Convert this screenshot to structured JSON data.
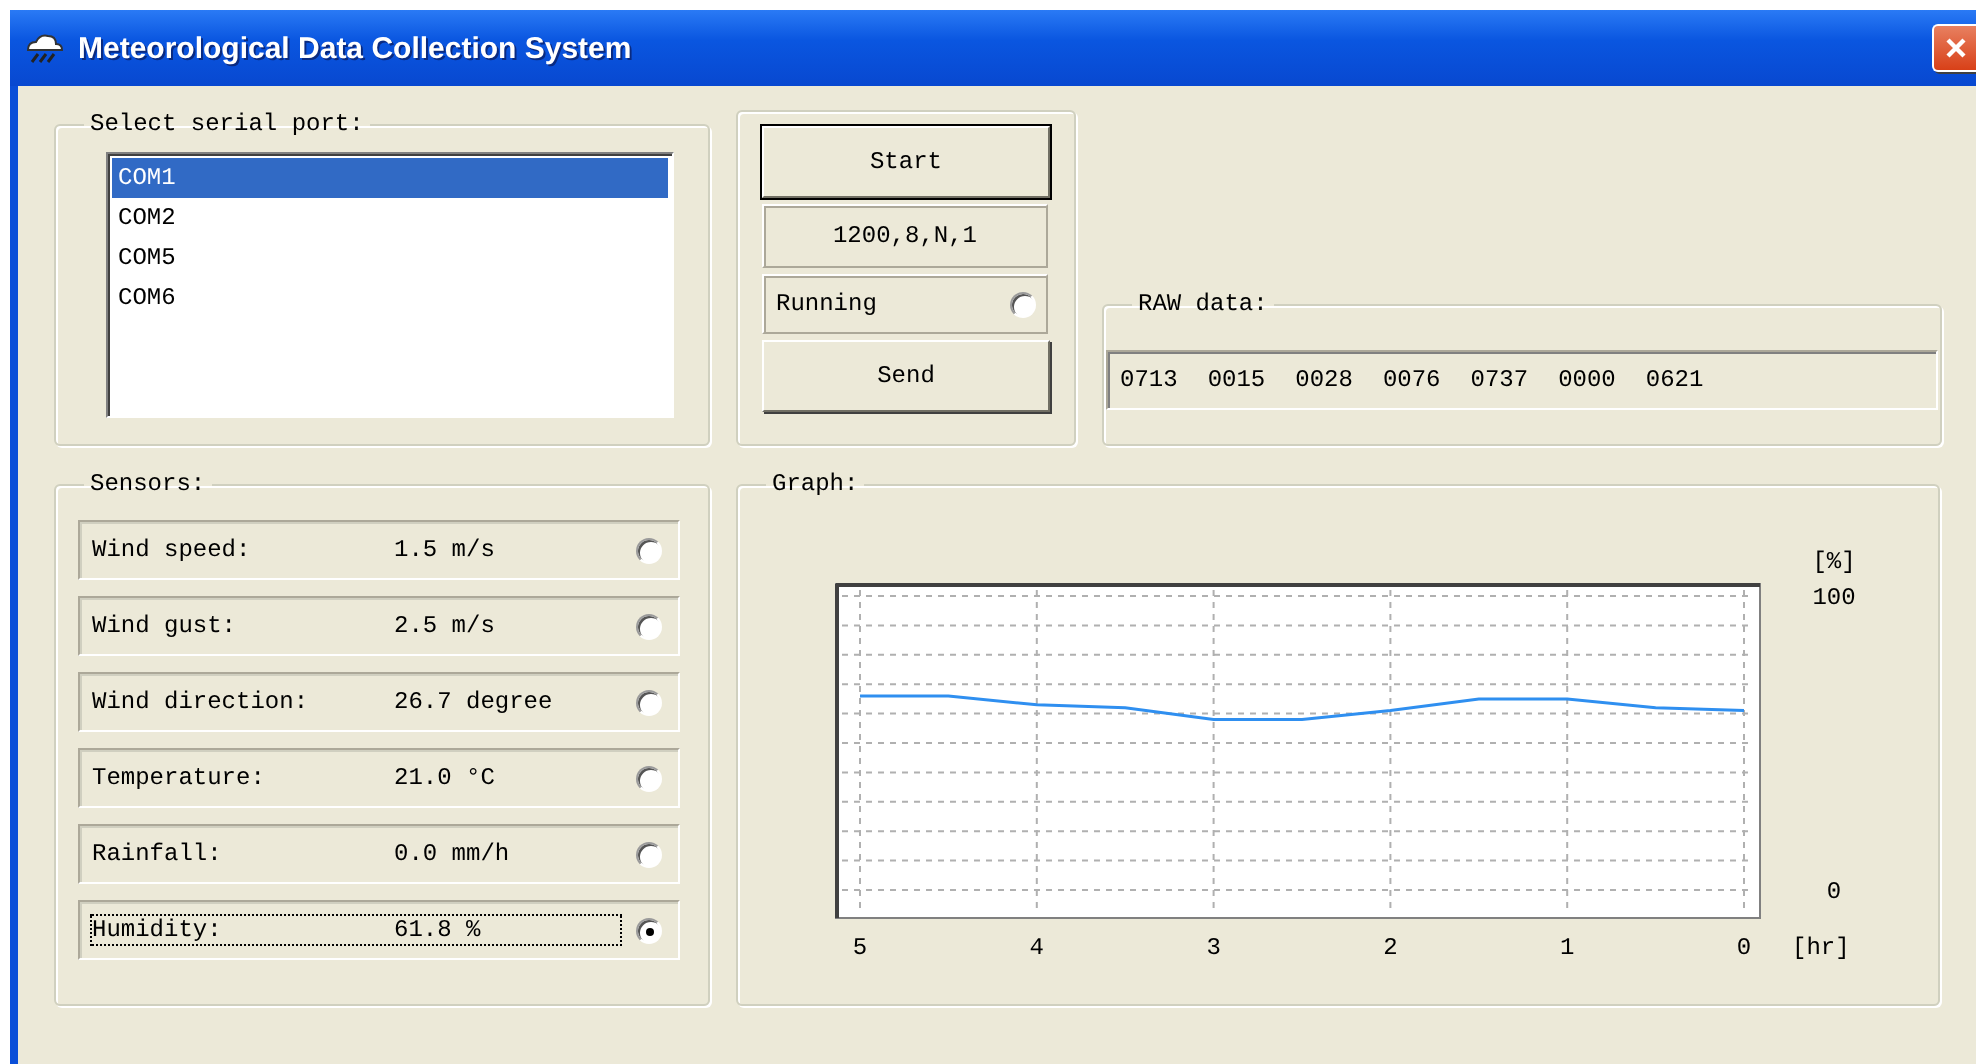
{
  "window": {
    "title": "Meteorological Data Collection System"
  },
  "serial_port": {
    "label": "Select serial port:",
    "ports": [
      {
        "name": "COM1",
        "selected": true
      },
      {
        "name": "COM2",
        "selected": false
      },
      {
        "name": "COM5",
        "selected": false
      },
      {
        "name": "COM6",
        "selected": false
      }
    ]
  },
  "controls": {
    "start_button": "Start",
    "settings": "1200,8,N,1",
    "running": {
      "label": "Running",
      "on": false
    },
    "send_button": "Send"
  },
  "raw_data": {
    "label": "RAW data:",
    "values": [
      "0713",
      "0015",
      "0028",
      "0076",
      "0737",
      "0000",
      "0621"
    ]
  },
  "sensors": {
    "label": "Sensors:",
    "items": [
      {
        "name": "Wind speed:",
        "value": "1.5 m/s",
        "selected": false,
        "focused": false
      },
      {
        "name": "Wind gust:",
        "value": "2.5 m/s",
        "selected": false,
        "focused": false
      },
      {
        "name": "Wind direction:",
        "value": "26.7 degree",
        "selected": false,
        "focused": false
      },
      {
        "name": "Temperature:",
        "value": "21.0 °C",
        "selected": false,
        "focused": false
      },
      {
        "name": "Rainfall:",
        "value": "0.0 mm/h",
        "selected": false,
        "focused": false
      },
      {
        "name": "Humidity:",
        "value": "61.8 %",
        "selected": true,
        "focused": true
      }
    ]
  },
  "graph": {
    "label": "Graph:",
    "chart_data": {
      "type": "line",
      "xlabel": "[hr]",
      "ylabel": "[%]",
      "x": [
        5,
        4.5,
        4,
        3.5,
        3,
        2.5,
        2,
        1.5,
        1,
        0.5,
        0
      ],
      "series": [
        {
          "color": "#2f8ff0",
          "values": [
            66,
            66,
            63,
            62,
            58,
            58,
            61,
            65,
            65,
            62,
            61
          ]
        }
      ],
      "grid": true,
      "xlim": [
        5,
        0
      ],
      "ylim": [
        0,
        100
      ],
      "xticks": [
        5,
        4,
        3,
        2,
        1,
        0
      ],
      "yticks": [
        0,
        100
      ]
    }
  }
}
